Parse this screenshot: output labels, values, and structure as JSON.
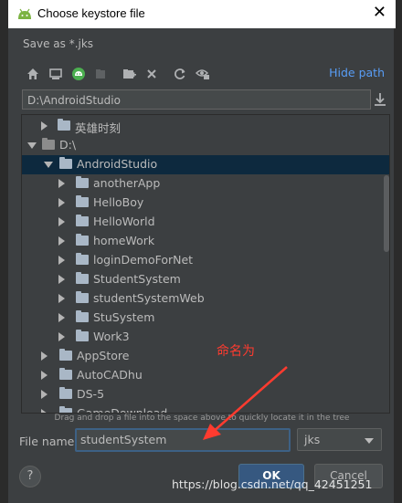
{
  "dialog": {
    "title": "Choose keystore file",
    "save_as": "Save as *.jks",
    "hide_path_label": "Hide path",
    "path_value": "D:\\AndroidStudio",
    "hint": "Drag and drop a file into the space above to quickly locate it in the tree",
    "file_name_label": "File name:",
    "file_name_value": "studentSystem",
    "extension": "jks",
    "help_label": "?",
    "ok_label": "OK",
    "cancel_label": "Cancel"
  },
  "toolbar": {
    "icons": [
      "home-icon",
      "desktop-icon",
      "android-project-icon",
      "module-icon",
      "new-folder-icon",
      "delete-icon",
      "refresh-icon",
      "show-hidden-icon"
    ]
  },
  "tree": {
    "rows": [
      {
        "label": "英雄时刻",
        "expanded": false
      },
      {
        "label": "D:\\",
        "expanded": true
      },
      {
        "label": "AndroidStudio",
        "expanded": true,
        "selected": true
      },
      {
        "label": "anotherApp",
        "expanded": false
      },
      {
        "label": "HelloBoy",
        "expanded": false
      },
      {
        "label": "HelloWorld",
        "expanded": false
      },
      {
        "label": "homeWork",
        "expanded": false
      },
      {
        "label": "loginDemoForNet",
        "expanded": false
      },
      {
        "label": "StudentSystem",
        "expanded": false
      },
      {
        "label": "studentSystemWeb",
        "expanded": false
      },
      {
        "label": "StuSystem",
        "expanded": false
      },
      {
        "label": "Work3",
        "expanded": false
      },
      {
        "label": "AppStore",
        "expanded": false
      },
      {
        "label": "AutoCADhu",
        "expanded": false
      },
      {
        "label": "DS-5",
        "expanded": false
      },
      {
        "label": "GameDownload",
        "expanded": false
      }
    ]
  },
  "annotation": {
    "text": "命名为",
    "color": "#ff3b2f"
  },
  "watermark": "https://blog.csdn.net/qq_42451251",
  "colors": {
    "selection": "#0d293e",
    "link": "#589df6",
    "ok_button": "#365880"
  }
}
